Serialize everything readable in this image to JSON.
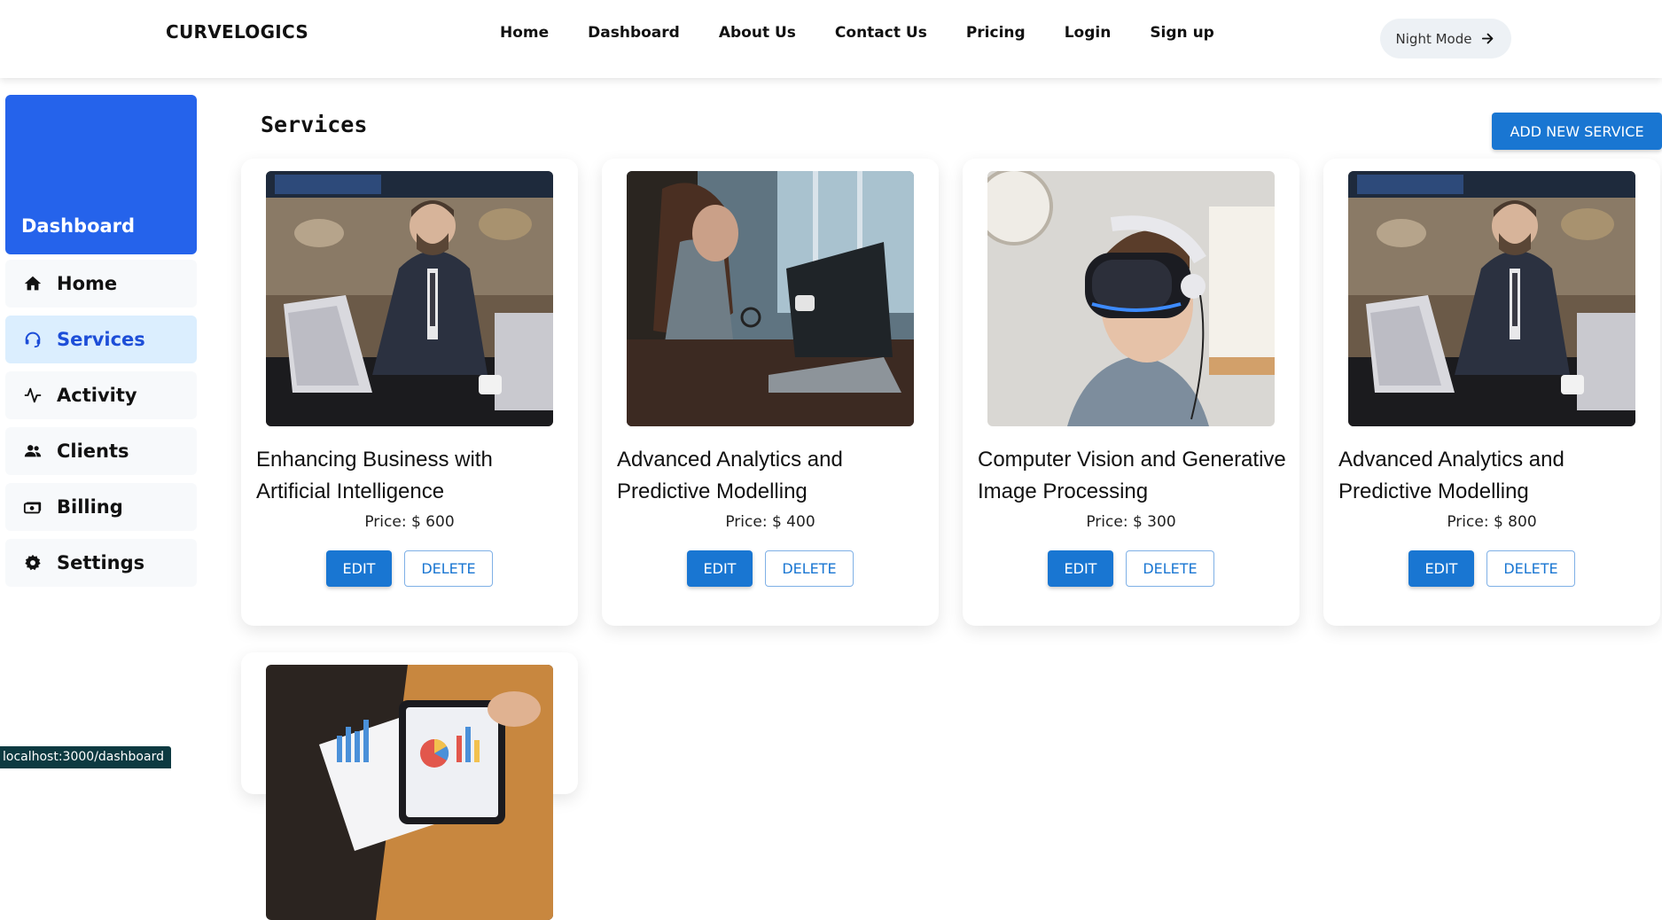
{
  "navbar": {
    "brand": "CURVELOGICS",
    "links": [
      "Home",
      "Dashboard",
      "About Us",
      "Contact Us",
      "Pricing",
      "Login",
      "Sign up"
    ],
    "night_mode_label": "Night Mode"
  },
  "sidebar": {
    "header": "Dashboard",
    "items": [
      {
        "label": "Home",
        "icon": "home-icon",
        "active": false
      },
      {
        "label": "Services",
        "icon": "headset-icon",
        "active": true
      },
      {
        "label": "Activity",
        "icon": "activity-icon",
        "active": false
      },
      {
        "label": "Clients",
        "icon": "people-icon",
        "active": false
      },
      {
        "label": "Billing",
        "icon": "money-icon",
        "active": false
      },
      {
        "label": "Settings",
        "icon": "gear-icon",
        "active": false
      }
    ]
  },
  "main": {
    "title": "Services",
    "add_button": "ADD NEW SERVICE",
    "edit_label": "EDIT",
    "delete_label": "DELETE",
    "cards": [
      {
        "title": "Enhancing Business with Artificial Intelligence",
        "price": "Price: $ 600",
        "image": "businessman-laptop-image"
      },
      {
        "title": "Advanced Analytics and Predictive Modelling",
        "price": "Price: $ 400",
        "image": "woman-laptop-image"
      },
      {
        "title": "Computer Vision and Generative Image Processing",
        "price": "Price: $ 300",
        "image": "vr-headset-boy-image"
      },
      {
        "title": "Advanced Analytics and Predictive Modelling",
        "price": "Price: $ 800",
        "image": "businessman-laptop-image"
      },
      {
        "title": "",
        "price": "",
        "image": "charts-tablet-image"
      }
    ]
  },
  "statusbar": {
    "url": "localhost:3000/dashboard"
  },
  "colors": {
    "accent": "#2563eb",
    "button": "#1976d2",
    "active_bg": "#dbeefe"
  }
}
